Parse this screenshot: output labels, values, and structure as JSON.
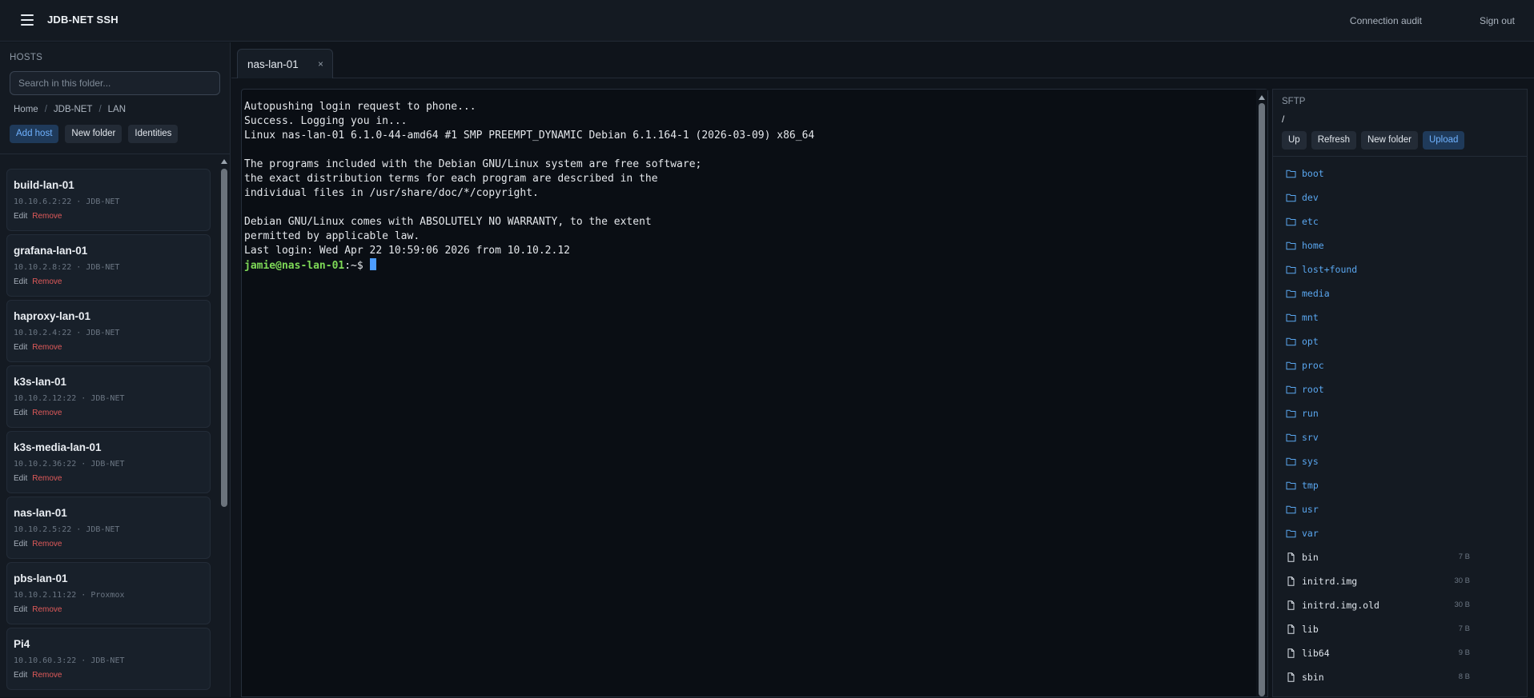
{
  "app": {
    "title": "JDB-NET SSH"
  },
  "topbar": {
    "audit_link": "Connection audit",
    "signout_link": "Sign out"
  },
  "sidebar": {
    "section_label": "HOSTS",
    "search_placeholder": "Search in this folder...",
    "breadcrumb": [
      "Home",
      "JDB-NET",
      "LAN"
    ],
    "actions": {
      "add_host": "Add host",
      "new_folder": "New folder",
      "identities": "Identities"
    },
    "hosts": [
      {
        "name": "build-lan-01",
        "address": "10.10.6.2:22",
        "group": "JDB-NET",
        "edit": "Edit",
        "remove": "Remove"
      },
      {
        "name": "grafana-lan-01",
        "address": "10.10.2.8:22",
        "group": "JDB-NET",
        "edit": "Edit",
        "remove": "Remove"
      },
      {
        "name": "haproxy-lan-01",
        "address": "10.10.2.4:22",
        "group": "JDB-NET",
        "edit": "Edit",
        "remove": "Remove"
      },
      {
        "name": "k3s-lan-01",
        "address": "10.10.2.12:22",
        "group": "JDB-NET",
        "edit": "Edit",
        "remove": "Remove"
      },
      {
        "name": "k3s-media-lan-01",
        "address": "10.10.2.36:22",
        "group": "JDB-NET",
        "edit": "Edit",
        "remove": "Remove"
      },
      {
        "name": "nas-lan-01",
        "address": "10.10.2.5:22",
        "group": "JDB-NET",
        "edit": "Edit",
        "remove": "Remove"
      },
      {
        "name": "pbs-lan-01",
        "address": "10.10.2.11:22",
        "group": "Proxmox",
        "edit": "Edit",
        "remove": "Remove"
      },
      {
        "name": "Pi4",
        "address": "10.10.60.3:22",
        "group": "JDB-NET",
        "edit": "Edit",
        "remove": "Remove"
      }
    ]
  },
  "tabs": [
    {
      "label": "nas-lan-01",
      "close": "×"
    }
  ],
  "terminal": {
    "lines": [
      "Autopushing login request to phone...",
      "Success. Logging you in...",
      "Linux nas-lan-01 6.1.0-44-amd64 #1 SMP PREEMPT_DYNAMIC Debian 6.1.164-1 (2026-03-09) x86_64",
      "",
      "The programs included with the Debian GNU/Linux system are free software;",
      "the exact distribution terms for each program are described in the",
      "individual files in /usr/share/doc/*/copyright.",
      "",
      "Debian GNU/Linux comes with ABSOLUTELY NO WARRANTY, to the extent",
      "permitted by applicable law.",
      "Last login: Wed Apr 22 10:59:06 2026 from 10.10.2.12"
    ],
    "prompt_user": "jamie@nas-lan-01",
    "prompt_path": ":~$"
  },
  "sftp": {
    "title": "SFTP",
    "path": "/",
    "actions": {
      "up": "Up",
      "refresh": "Refresh",
      "new_folder": "New folder",
      "upload": "Upload"
    },
    "entries": [
      {
        "name": "boot",
        "type": "dir",
        "size": ""
      },
      {
        "name": "dev",
        "type": "dir",
        "size": ""
      },
      {
        "name": "etc",
        "type": "dir",
        "size": ""
      },
      {
        "name": "home",
        "type": "dir",
        "size": ""
      },
      {
        "name": "lost+found",
        "type": "dir",
        "size": ""
      },
      {
        "name": "media",
        "type": "dir",
        "size": ""
      },
      {
        "name": "mnt",
        "type": "dir",
        "size": ""
      },
      {
        "name": "opt",
        "type": "dir",
        "size": ""
      },
      {
        "name": "proc",
        "type": "dir",
        "size": ""
      },
      {
        "name": "root",
        "type": "dir",
        "size": ""
      },
      {
        "name": "run",
        "type": "dir",
        "size": ""
      },
      {
        "name": "srv",
        "type": "dir",
        "size": ""
      },
      {
        "name": "sys",
        "type": "dir",
        "size": ""
      },
      {
        "name": "tmp",
        "type": "dir",
        "size": ""
      },
      {
        "name": "usr",
        "type": "dir",
        "size": ""
      },
      {
        "name": "var",
        "type": "dir",
        "size": ""
      },
      {
        "name": "bin",
        "type": "file",
        "size": "7 B"
      },
      {
        "name": "initrd.img",
        "type": "file",
        "size": "30 B"
      },
      {
        "name": "initrd.img.old",
        "type": "file",
        "size": "30 B"
      },
      {
        "name": "lib",
        "type": "file",
        "size": "7 B"
      },
      {
        "name": "lib64",
        "type": "file",
        "size": "9 B"
      },
      {
        "name": "sbin",
        "type": "file",
        "size": "8 B"
      }
    ]
  },
  "icons": {
    "menu": "hamburger-menu-icon",
    "folder": "folder-icon",
    "file": "file-icon",
    "close": "close-icon"
  },
  "colors": {
    "accent": "#4d9dff",
    "danger": "#e05a5a",
    "prompt": "#7ed957",
    "background": "#0f141b"
  }
}
